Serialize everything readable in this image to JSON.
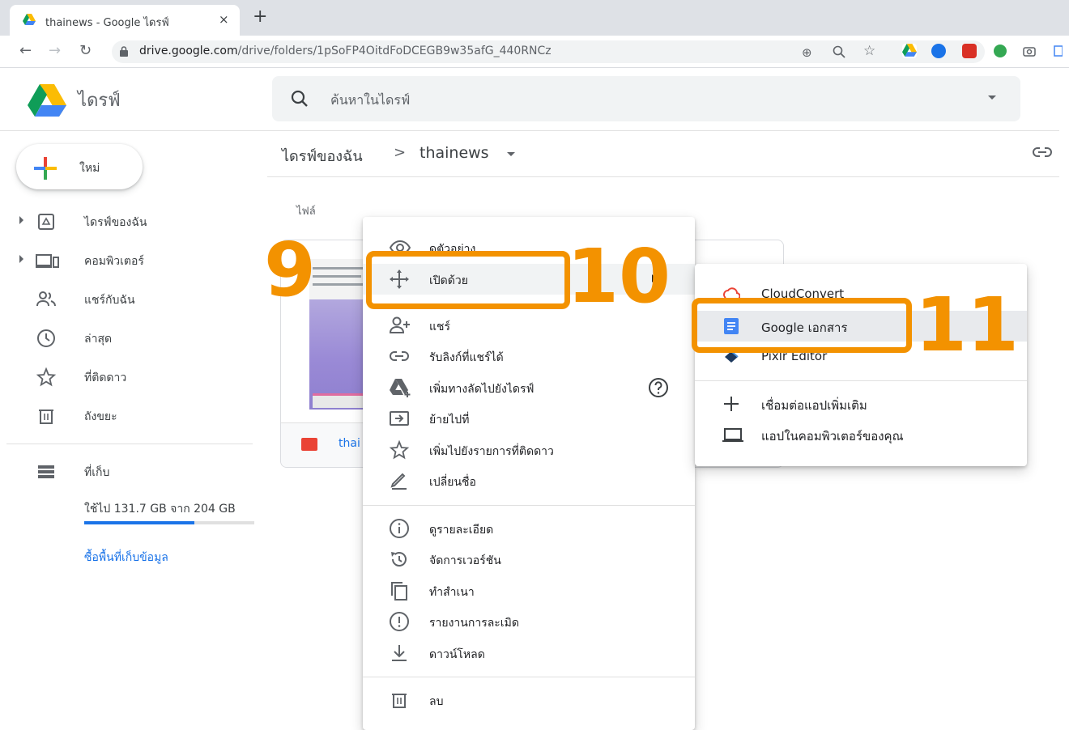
{
  "browser": {
    "tab_title": "thainews - Google ไดรฟ์",
    "tab_close": "×",
    "new_tab": "+",
    "url_host": "drive.google.com",
    "url_path": "/drive/folders/1pSoFP4OitdFoDCEGB9w35afG_440RNCz"
  },
  "app": {
    "title": "ไดรฟ์",
    "search_placeholder": "ค้นหาในไดรฟ์"
  },
  "sidebar": {
    "new_label": "ใหม่",
    "items": [
      {
        "label": "ไดรฟ์ของฉัน"
      },
      {
        "label": "คอมพิวเตอร์"
      },
      {
        "label": "แชร์กับฉัน"
      },
      {
        "label": "ล่าสุด"
      },
      {
        "label": "ที่ติดดาว"
      },
      {
        "label": "ถังขยะ"
      }
    ],
    "storage_label": "ที่เก็บ",
    "quota_text": "ใช้ไป 131.7 GB จาก 204 GB",
    "quota_fraction": 0.646,
    "buy_storage": "ซื้อพื้นที่เก็บข้อมูล"
  },
  "main": {
    "breadcrumb_root": "ไดรฟ์ของฉัน",
    "breadcrumb_sep": ">",
    "breadcrumb_current": "thainews",
    "files_heading": "ไฟล์",
    "file_name": "thai"
  },
  "context_menu": {
    "items": [
      {
        "label": "ดูตัวอย่าง"
      },
      {
        "label": "เปิดด้วย"
      },
      {
        "label": "แชร์"
      },
      {
        "label": "รับลิงก์ที่แชร์ได้"
      },
      {
        "label": "เพิ่มทางลัดไปยังไดรฟ์"
      },
      {
        "label": "ย้ายไปที่"
      },
      {
        "label": "เพิ่มไปยังรายการที่ติดดาว"
      },
      {
        "label": "เปลี่ยนชื่อ"
      },
      {
        "label": "ดูรายละเอียด"
      },
      {
        "label": "จัดการเวอร์ชัน"
      },
      {
        "label": "ทำสำเนา"
      },
      {
        "label": "รายงานการละเมิด"
      },
      {
        "label": "ดาวน์โหลด"
      },
      {
        "label": "ลบ"
      }
    ]
  },
  "open_with_menu": {
    "items": [
      {
        "label": "CloudConvert"
      },
      {
        "label": "Google เอกสาร"
      },
      {
        "label": "Pixlr Editor"
      },
      {
        "label": "เชื่อมต่อแอปเพิ่มเติม"
      },
      {
        "label": "แอปในคอมพิวเตอร์ของคุณ"
      }
    ]
  },
  "annotations": {
    "step_a": "9",
    "step_b": "10",
    "step_c": "11",
    "color": "#f39200"
  }
}
